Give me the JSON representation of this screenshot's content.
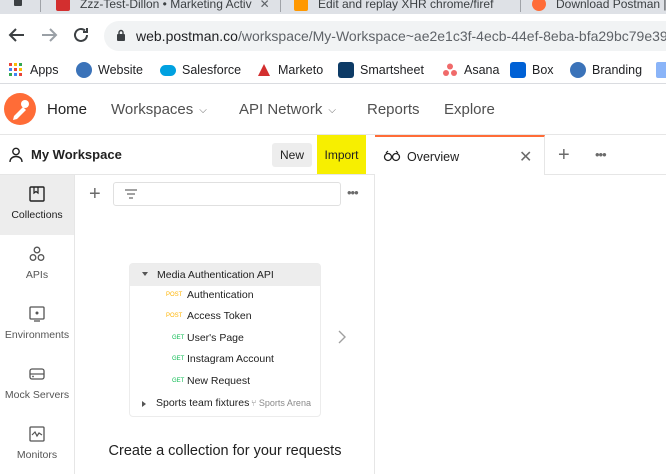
{
  "browser": {
    "tabs": [
      {
        "title": "Zzz-Test-Dillon • Marketing Activ",
        "favicon_color": "#d32f2f"
      },
      {
        "title": "Edit and replay XHR chrome/firef",
        "favicon_color": "#ff9800"
      },
      {
        "title": "Download Postman |",
        "favicon_color": "#ff6c37"
      }
    ],
    "url_host": "web.postman.co",
    "url_path": "/workspace/My-Workspace~ae2e1c3f-4ecb-44ef-8eba-bfa29bc79e39"
  },
  "bookmarks": [
    {
      "label": "Apps",
      "icon": "apps-grid-icon",
      "color": "#4285f4"
    },
    {
      "label": "Website",
      "icon": "ge-logo-icon",
      "color": "#3b73b9"
    },
    {
      "label": "Salesforce",
      "icon": "salesforce-cloud-icon",
      "color": "#00a1e0"
    },
    {
      "label": "Marketo",
      "icon": "marketo-icon",
      "color": "#5c4c9f"
    },
    {
      "label": "Smartsheet",
      "icon": "smartsheet-icon",
      "color": "#0d3b66"
    },
    {
      "label": "Asana",
      "icon": "asana-icon",
      "color": "#f06a6a"
    },
    {
      "label": "Box",
      "icon": "box-icon",
      "color": "#0061d5"
    },
    {
      "label": "Branding",
      "icon": "ge-logo-icon",
      "color": "#3b73b9"
    }
  ],
  "postman": {
    "nav": {
      "home": "Home",
      "workspaces": "Workspaces",
      "api_network": "API Network",
      "reports": "Reports",
      "explore": "Explore"
    },
    "workspace_title": "My Workspace",
    "new_label": "New",
    "import_label": "Import",
    "rail": [
      {
        "label": "Collections",
        "icon": "collections-icon",
        "active": true
      },
      {
        "label": "APIs",
        "icon": "apis-icon",
        "active": false
      },
      {
        "label": "Environments",
        "icon": "environments-icon",
        "active": false
      },
      {
        "label": "Mock Servers",
        "icon": "mock-servers-icon",
        "active": false
      },
      {
        "label": "Monitors",
        "icon": "monitors-icon",
        "active": false
      }
    ],
    "illustration": {
      "collection_name": "Media Authentication API",
      "requests": [
        {
          "method": "POST",
          "name": "Authentication"
        },
        {
          "method": "POST",
          "name": "Access Token"
        },
        {
          "method": "GET",
          "name": "User's Page"
        },
        {
          "method": "GET",
          "name": "Instagram Account"
        },
        {
          "method": "GET",
          "name": "New Request"
        }
      ],
      "fixture_name": "Sports team fixtures",
      "fixture_fork": "Sports Arena"
    },
    "empty_cta": "Create a collection for your requests",
    "tab": {
      "label": "Overview"
    },
    "colors": {
      "accent": "#ff6c37",
      "import_highlight": "#f7ef00"
    }
  }
}
